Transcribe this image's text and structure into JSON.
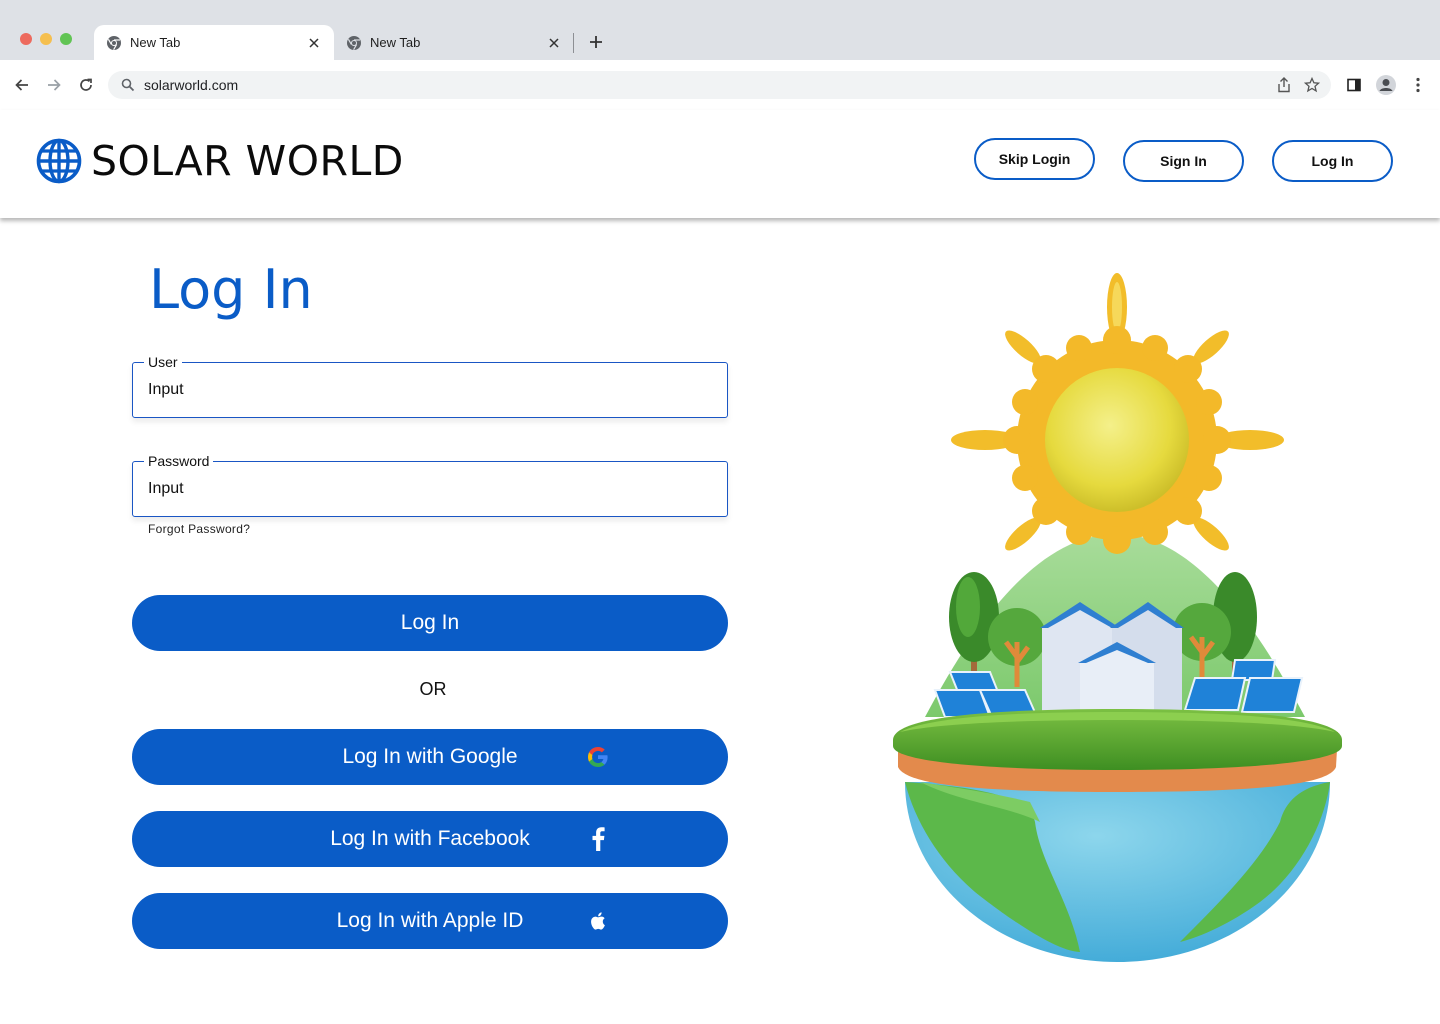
{
  "browser": {
    "tabs": [
      {
        "title": "New Tab",
        "active": true
      },
      {
        "title": "New Tab",
        "active": false
      }
    ],
    "url": "solarworld.com"
  },
  "header": {
    "logo_text": "SOLAR WORLD",
    "buttons": {
      "skip_login": "Skip Login",
      "sign_in": "Sign In",
      "log_in": "Log In"
    }
  },
  "login": {
    "title": "Log In",
    "user": {
      "label": "User",
      "value": "Input"
    },
    "password": {
      "label": "Password",
      "value": "Input"
    },
    "forgot_password": "Forgot Password?",
    "submit_label": "Log In",
    "or_label": "OR",
    "social": {
      "google": "Log In with Google",
      "facebook": "Log In with Facebook",
      "apple": "Log In with Apple ID"
    }
  },
  "colors": {
    "accent": "#0a5cc7",
    "tab_strip": "#dee1e6"
  },
  "icons": [
    "chrome-icon",
    "close-icon",
    "plus-icon",
    "back-arrow-icon",
    "forward-arrow-icon",
    "reload-icon",
    "search-icon",
    "share-icon",
    "star-icon",
    "sidepanel-icon",
    "profile-icon",
    "more-vert-icon",
    "globe-icon",
    "google-icon",
    "facebook-icon",
    "apple-icon"
  ]
}
